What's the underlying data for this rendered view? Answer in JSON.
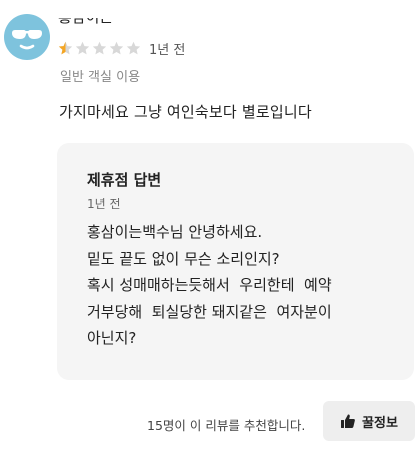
{
  "review": {
    "username": "홍삼이는",
    "rating": 0.5,
    "rating_max": 5,
    "star_color": "#f5a623",
    "star_empty_color": "#d8d8d8",
    "date": "1년 전",
    "room_type": "일반 객실 이용",
    "text": "가지마세요 그냥 여인숙보다 별로입니다"
  },
  "reply": {
    "title": "제휴점 답변",
    "date": "1년 전",
    "lines": [
      "홍삼이는백수님 안녕하세요.",
      "밑도 끝도 없이 무슨 소리인지?",
      "혹시 성매매하는듯해서  우리한테  예약",
      "거부당해  퇴실당한 돼지같은  여자분이",
      "아닌지?"
    ]
  },
  "footer": {
    "recommend_text": "15명이 이 리뷰를 추천합니다.",
    "helpful_label": "꿀정보",
    "helpful_icon": "thumbs-up-icon"
  },
  "avatar": {
    "icon": "sunglasses-face-icon",
    "color": "#7ec3dd"
  }
}
